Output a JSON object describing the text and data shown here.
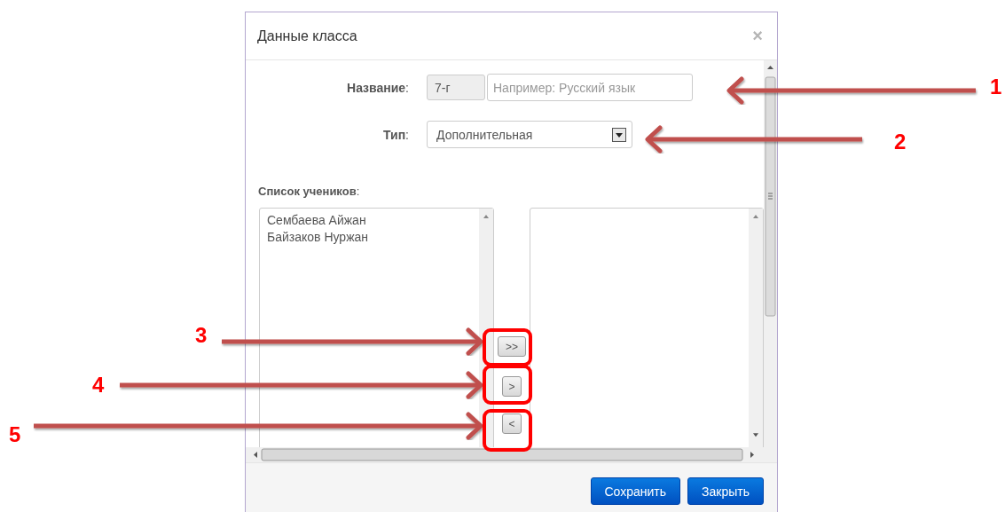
{
  "dialog": {
    "title": "Данные класса",
    "close": "×"
  },
  "form": {
    "name_label": "**Название**:",
    "name_prefix": {
      "value": "7-г",
      "disabled": true
    },
    "name_field": {
      "placeholder": "Например: Русский язык"
    },
    "type_label": "**Тип**:",
    "type_select": {
      "value": "Дополнительная"
    }
  },
  "students_label": "**Список учеников**:",
  "available_students": [
    "Сембаева Айжан",
    "Байзаков Нуржан"
  ],
  "transfer_buttons": [
    {
      "label": ">>"
    },
    {
      "label": ">"
    },
    {
      "label": "<"
    }
  ],
  "footer_buttons": [
    {
      "label": "Сохранить"
    },
    {
      "label": "Закрыть"
    }
  ],
  "annotations": [
    {
      "number": "1"
    },
    {
      "number": "2"
    },
    {
      "number": "3"
    },
    {
      "number": "4"
    },
    {
      "number": "5"
    }
  ]
}
